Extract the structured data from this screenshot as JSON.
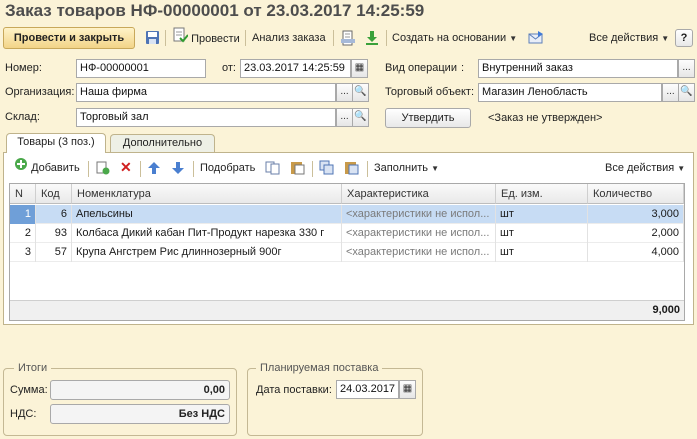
{
  "title": "Заказ товаров НФ-00000001 от 23.03.2017 14:25:59",
  "toolbar": {
    "post_close": "Провести и закрыть",
    "post": "Провести",
    "analysis": "Анализ заказа",
    "create_based": "Создать на основании",
    "all_actions": "Все действия",
    "help": "?"
  },
  "form": {
    "number_label": "Номер:",
    "number_value": "НФ-00000001",
    "date_label": "от:",
    "date_value": "23.03.2017 14:25:59",
    "operation_label": "Вид операции",
    "operation_value": "Внутренний заказ",
    "org_label": "Организация:",
    "org_value": "Наша фирма",
    "trade_object_label": "Торговый объект:",
    "trade_object_value": "Магазин Ленобласть",
    "warehouse_label": "Склад:",
    "warehouse_value": "Торговый зал",
    "approve_button": "Утвердить",
    "status_text": "<Заказ не утвержден>"
  },
  "tabs": [
    {
      "label": "Товары (3 поз.)",
      "active": true
    },
    {
      "label": "Дополнительно",
      "active": false
    }
  ],
  "table_toolbar": {
    "add": "Добавить",
    "pick": "Подобрать",
    "fill": "Заполнить",
    "all_actions": "Все действия"
  },
  "table": {
    "headers": [
      "N",
      "Код",
      "Номенклатура",
      "Характеристика",
      "Ед. изм.",
      "Количество"
    ],
    "rows": [
      {
        "n": "1",
        "code": "6",
        "name": "Апельсины",
        "characteristic": "<характеристики не испол...",
        "unit": "шт",
        "qty": "3,000",
        "selected": true
      },
      {
        "n": "2",
        "code": "93",
        "name": "Колбаса Дикий кабан Пит-Продукт нарезка 330 г",
        "characteristic": "<характеристики не испол...",
        "unit": "шт",
        "qty": "2,000",
        "selected": false
      },
      {
        "n": "3",
        "code": "57",
        "name": "Крупа Ангстрем Рис длиннозерный 900г",
        "characteristic": "<характеристики не испол...",
        "unit": "шт",
        "qty": "4,000",
        "selected": false
      }
    ],
    "total": "9,000"
  },
  "totals": {
    "group_title": "Итоги",
    "sum_label": "Сумма:",
    "sum_value": "0,00",
    "vat_label": "НДС:",
    "vat_value": "Без НДС"
  },
  "delivery": {
    "group_title": "Планируемая поставка",
    "date_label": "Дата поставки:",
    "date_value": "24.03.2017"
  }
}
